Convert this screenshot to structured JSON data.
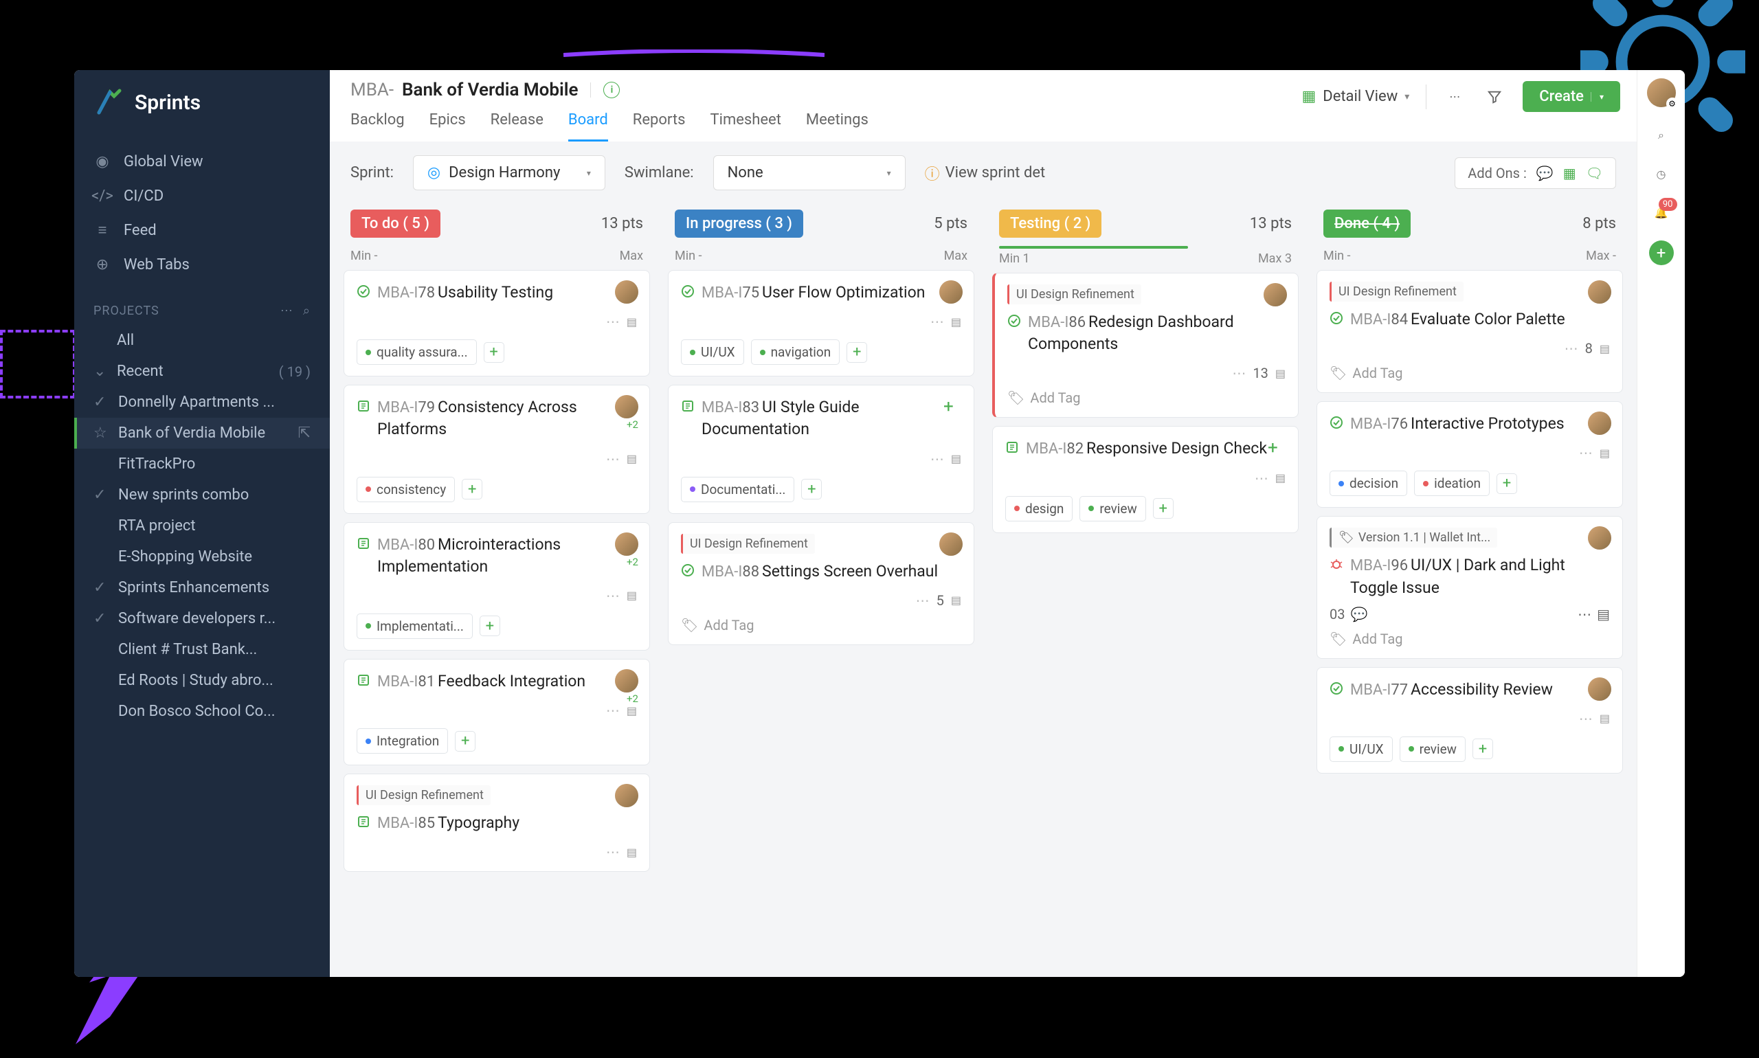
{
  "app": {
    "name": "Sprints"
  },
  "sidebar": {
    "nav": [
      {
        "label": "Global View"
      },
      {
        "label": "CI/CD"
      },
      {
        "label": "Feed"
      },
      {
        "label": "Web Tabs"
      }
    ],
    "projects_label": "PROJECTS",
    "all_label": "All",
    "recent_label": "Recent",
    "recent_count": "( 19 )",
    "projects": [
      {
        "name": "Donnelly Apartments ...",
        "check": true
      },
      {
        "name": "Bank of Verdia Mobile",
        "star": true,
        "active": true,
        "ext": true
      },
      {
        "name": "FitTrackPro"
      },
      {
        "name": "New sprints combo",
        "check": true
      },
      {
        "name": "RTA project"
      },
      {
        "name": "E-Shopping Website"
      },
      {
        "name": "Sprints Enhancements",
        "check": true
      },
      {
        "name": "Software developers r...",
        "check": true
      },
      {
        "name": "Client # Trust Bank..."
      },
      {
        "name": "Ed Roots | Study abro..."
      },
      {
        "name": "Don Bosco School Co..."
      }
    ]
  },
  "header": {
    "prefix": "MBA-",
    "title": "Bank of Verdia Mobile",
    "tabs": [
      "Backlog",
      "Epics",
      "Release",
      "Board",
      "Reports",
      "Timesheet",
      "Meetings"
    ],
    "active_tab": "Board",
    "detail_view": "Detail View",
    "create": "Create"
  },
  "filter": {
    "sprint_label": "Sprint:",
    "sprint_value": "Design Harmony",
    "swimlane_label": "Swimlane:",
    "swimlane_value": "None",
    "view_detail": "View sprint det",
    "addons_label": "Add Ons :"
  },
  "rail": {
    "notif_count": "90"
  },
  "columns": [
    {
      "name": "To do",
      "count": "( 5 )",
      "pill": "pill-red",
      "pts": "13 pts",
      "min": "Min -",
      "max": "Max",
      "cards": [
        {
          "type": "task",
          "id_prefix": "MBA-I",
          "id_num": "78",
          "title": "Usability Testing",
          "avatar": true,
          "tags": [
            {
              "dot": "dot-green",
              "text": "quality assura..."
            }
          ],
          "tagadd": true
        },
        {
          "type": "story",
          "id_prefix": "MBA-I",
          "id_num": "79",
          "title": "Consistency Across Platforms",
          "avatar": true,
          "avatar_plus": "+2",
          "tags": [
            {
              "dot": "dot-red",
              "text": "consistency"
            }
          ],
          "tagadd": true
        },
        {
          "type": "story",
          "id_prefix": "MBA-I",
          "id_num": "80",
          "title": "Microinteractions Implementation",
          "avatar": true,
          "avatar_plus": "+2",
          "tags": [
            {
              "dot": "dot-green",
              "text": "Implementati..."
            }
          ],
          "tagadd": true
        },
        {
          "type": "story",
          "id_prefix": "MBA-I",
          "id_num": "81",
          "title": "Feedback Integration",
          "avatar": true,
          "avatar_plus": "+2",
          "tags": [
            {
              "dot": "dot-blue",
              "text": "Integration"
            }
          ],
          "tagadd": true
        },
        {
          "epic": "UI Design Refinement",
          "type": "story",
          "id_prefix": "MBA-I",
          "id_num": "85",
          "title": "Typography",
          "avatar": true
        }
      ]
    },
    {
      "name": "In progress",
      "count": "( 3 )",
      "pill": "pill-blue",
      "pts": "5 pts",
      "min": "Min -",
      "max": "Max",
      "cards": [
        {
          "type": "task",
          "id_prefix": "MBA-I",
          "id_num": "75",
          "title": "User Flow Optimization",
          "avatar": true,
          "tags": [
            {
              "dot": "dot-green",
              "text": "UI/UX"
            },
            {
              "dot": "dot-green",
              "text": "navigation"
            }
          ],
          "tagadd": true
        },
        {
          "type": "story",
          "id_prefix": "MBA-I",
          "id_num": "83",
          "title": "UI Style Guide Documentation",
          "addbtn": true,
          "tags": [
            {
              "dot": "dot-purple",
              "text": "Documentati..."
            }
          ],
          "tagadd": true
        },
        {
          "epic": "UI Design Refinement",
          "type": "task",
          "id_prefix": "MBA-I",
          "id_num": "88",
          "title": "Settings Screen Overhaul",
          "avatar": true,
          "count": "5",
          "addtag_plain": "Add Tag"
        }
      ]
    },
    {
      "name": "Testing",
      "count": "( 2 )",
      "pill": "pill-yellow",
      "pts": "13 pts",
      "min": "Min 1",
      "max": "Max 3",
      "progress": true,
      "cards": [
        {
          "epic": "UI Design Refinement",
          "type": "task",
          "id_prefix": "MBA-I",
          "id_num": "86",
          "title": "Redesign Dashboard Components",
          "avatar": true,
          "count": "13",
          "addtag_plain": "Add Tag",
          "highlight": true
        },
        {
          "type": "story",
          "id_prefix": "MBA-I",
          "id_num": "82",
          "title": "Responsive Design Check",
          "addbtn": true,
          "tags": [
            {
              "dot": "dot-red",
              "text": "design"
            },
            {
              "dot": "dot-green",
              "text": "review"
            }
          ],
          "tagadd": true
        }
      ]
    },
    {
      "name": "Done",
      "count": "( 4 )",
      "pill": "pill-green",
      "pts": "8 pts",
      "min": "Min -",
      "max": "Max -",
      "cards": [
        {
          "epic": "UI Design Refinement",
          "type": "task",
          "id_prefix": "MBA-I",
          "id_num": "84",
          "title": "Evaluate Color Palette",
          "avatar": true,
          "count": "8",
          "addtag_plain": "Add Tag"
        },
        {
          "type": "task",
          "id_prefix": "MBA-I",
          "id_num": "76",
          "title": "Interactive Prototypes",
          "avatar": true,
          "tags": [
            {
              "dot": "dot-blue",
              "text": "decision"
            },
            {
              "dot": "dot-red",
              "text": "ideation"
            }
          ],
          "tagadd": true
        },
        {
          "ver": "Version 1.1 | Wallet Int...",
          "type": "bug",
          "id_prefix": "MBA-I",
          "id_num": "96",
          "title": "UI/UX | Dark and Light Toggle Issue",
          "avatar": true,
          "count_prefix": "03",
          "addtag_plain": "Add Tag"
        },
        {
          "type": "task",
          "id_prefix": "MBA-I",
          "id_num": "77",
          "title": "Accessibility Review",
          "avatar": true,
          "tags": [
            {
              "dot": "dot-green",
              "text": "UI/UX"
            },
            {
              "dot": "dot-green",
              "text": "review"
            }
          ],
          "tagadd": true
        }
      ]
    }
  ]
}
